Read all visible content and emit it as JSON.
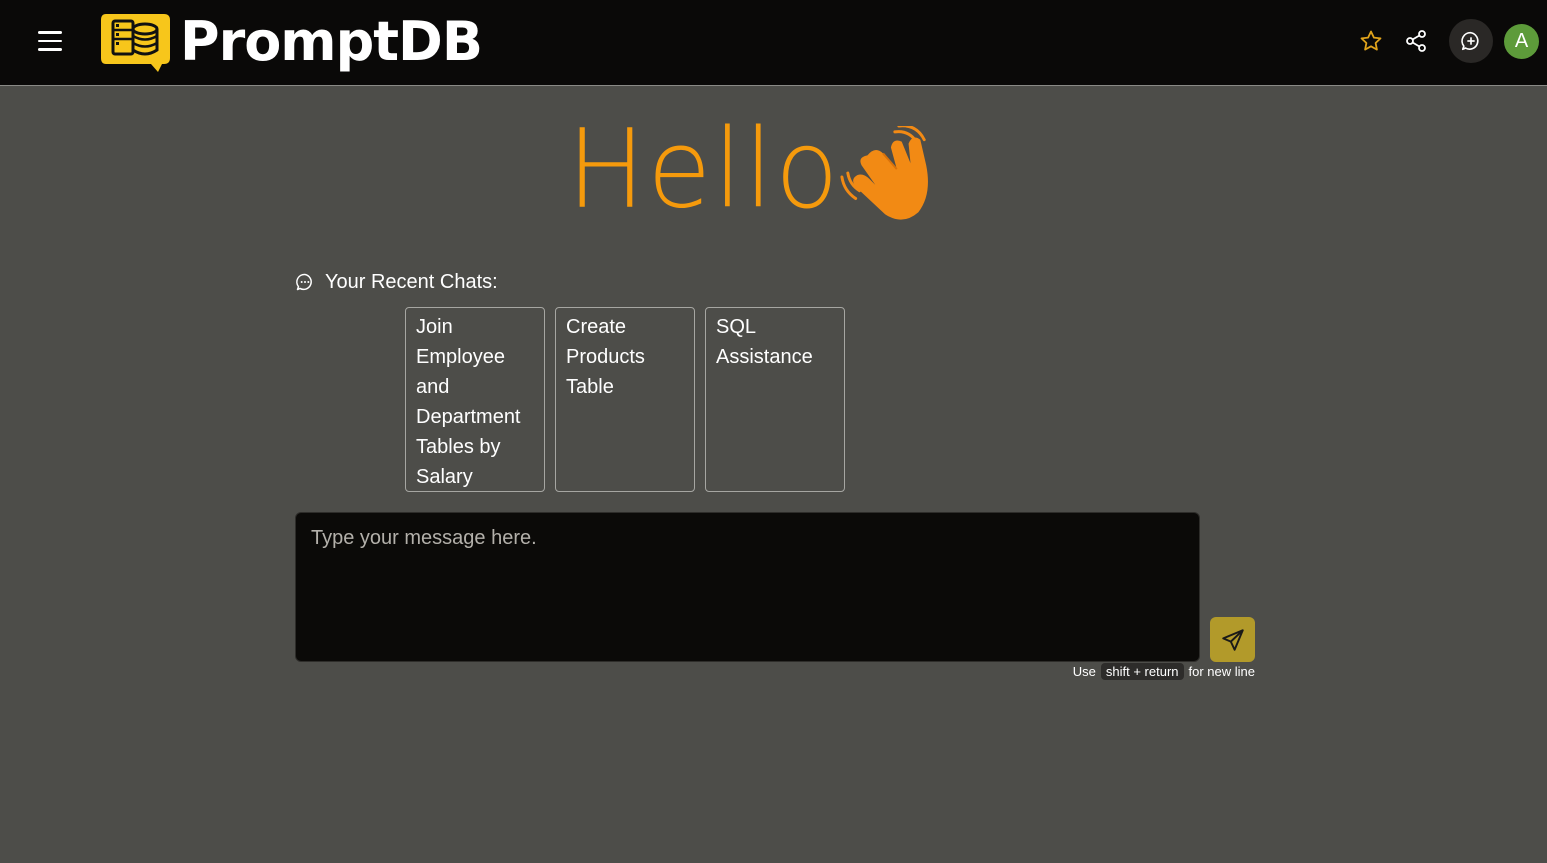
{
  "header": {
    "brand": "PromptDB",
    "icons": {
      "menu": "hamburger-menu-icon",
      "logo": "database-chat-logo",
      "star": "star-icon",
      "share": "share-icon",
      "new_chat": "new-chat-icon"
    },
    "avatar_initial": "A",
    "colors": {
      "background": "#0a0908",
      "logo_yellow": "#f7c61b",
      "star": "#e0a31b",
      "avatar": "#5d9b3a"
    }
  },
  "greeting": {
    "text": "Hello",
    "emoji_icon": "waving-hand-icon",
    "color": "#f59a0c"
  },
  "recent": {
    "label": "Your Recent Chats:",
    "icon": "chat-bubble-icon",
    "chats": [
      {
        "title": "Join Employee and Department Tables by Salary"
      },
      {
        "title": "Create Products Table"
      },
      {
        "title": "SQL Assistance"
      }
    ]
  },
  "composer": {
    "placeholder": "Type your message here.",
    "value": "",
    "send_icon": "send-icon",
    "hint_prefix": "Use",
    "hint_keys": "shift + return",
    "hint_suffix": "for new line",
    "colors": {
      "send_button": "#b29a2a",
      "input_background": "#0b0a08"
    }
  },
  "page": {
    "background": "#4d4d49"
  }
}
